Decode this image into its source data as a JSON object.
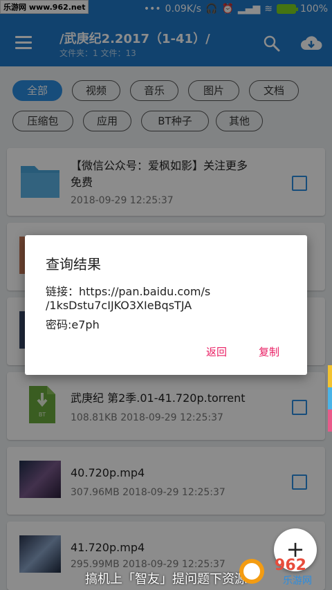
{
  "status_bar": {
    "watermark": "乐游网 www.962.net",
    "speed": "0.09K/s",
    "battery": "100%"
  },
  "app_bar": {
    "title": "/武庚纪2.2017（1-41）/",
    "subtitle": "文件夹：1 文件：13"
  },
  "filters": [
    {
      "label": "全部",
      "active": true
    },
    {
      "label": "视频",
      "active": false
    },
    {
      "label": "音乐",
      "active": false
    },
    {
      "label": "图片",
      "active": false
    },
    {
      "label": "文档",
      "active": false
    },
    {
      "label": "压缩包",
      "active": false
    },
    {
      "label": "应用",
      "active": false
    },
    {
      "label": "BT种子",
      "active": false
    },
    {
      "label": "其他",
      "active": false
    }
  ],
  "files": [
    {
      "name_line1": "【微信公众号：爱枫如影】关注更多",
      "name_line2": "免费",
      "meta": "2018-09-29 12:25:37",
      "icon": "folder-icon"
    },
    {
      "name_line1": "武庚纪 第2季.01-41.720p.torrent",
      "name_line2": "",
      "meta": "108.81KB 2018-09-29 12:25:37",
      "icon": "torrent-icon"
    },
    {
      "name_line1": "40.720p.mp4",
      "name_line2": "",
      "meta": "307.96MB 2018-09-29 12:25:37",
      "icon": "video-thumbnail"
    },
    {
      "name_line1": "41.720p.mp4",
      "name_line2": "",
      "meta": "295.99MB 2018-09-29 12:25:37",
      "icon": "video-thumbnail"
    }
  ],
  "dialog": {
    "title": "查询结果",
    "line1": "链接：https://pan.baidu.com/s",
    "line2": "/1ksDstu7cIJKO3XIeBqsTJA",
    "line3": "密码:e7ph",
    "back": "返回",
    "copy": "复制"
  },
  "fab": {
    "label": "+"
  },
  "footer_caption": "搞机上「智友」提问题下资源",
  "logo": {
    "top": "962",
    "bottom": "乐游网"
  },
  "colors": {
    "primary": "#1f78c8",
    "accent": "#e91e63",
    "chip_active": "#2b8de0"
  }
}
